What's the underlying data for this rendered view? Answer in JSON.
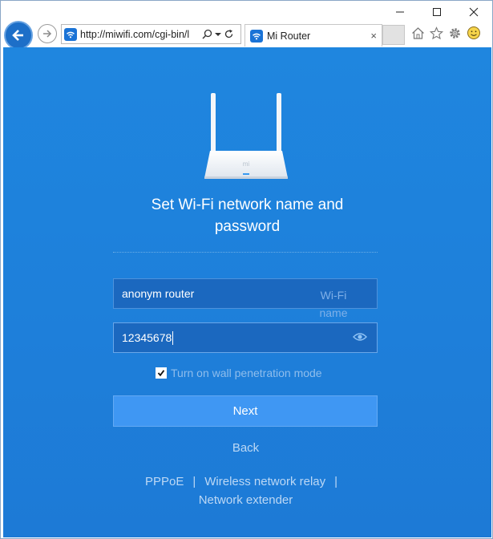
{
  "browser": {
    "address_url": "http://miwifi.com/cgi-bin/l",
    "tab_title": "Mi Router",
    "tab_close": "×"
  },
  "page": {
    "heading_line1": "Set Wi-Fi network name and",
    "heading_line2": "password",
    "router_logo_text": "mi",
    "ssid_value": "anonym router",
    "ssid_hint": "Wi-Fi name",
    "password_value": "12345678",
    "wall_mode_label": "Turn on wall penetration mode",
    "wall_mode_checked": true,
    "next_label": "Next",
    "back_label": "Back",
    "link_pppoe": "PPPoE",
    "link_relay": "Wireless network relay",
    "link_extender": "Network extender",
    "separator": "|"
  },
  "colors": {
    "page_bg": "#1f86df",
    "field_bg": "#1b68bf",
    "button_bg": "#3f97f3"
  },
  "icons": [
    "back-icon",
    "forward-icon",
    "wifi-icon",
    "search-icon",
    "dropdown-icon",
    "refresh-icon",
    "home-icon",
    "star-icon",
    "gear-icon",
    "smiley-icon",
    "eye-icon",
    "checkmark-icon",
    "minimize-icon",
    "maximize-icon",
    "close-icon"
  ]
}
